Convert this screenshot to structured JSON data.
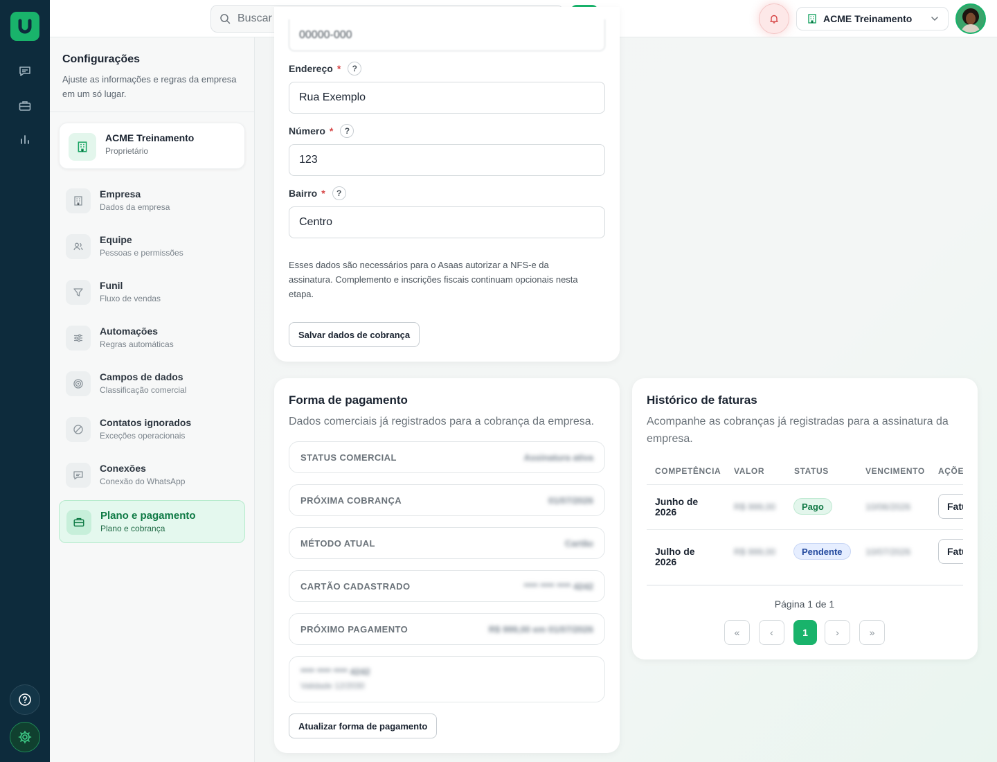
{
  "topbar": {
    "search_placeholder": "Buscar conversas, negócios e telefones",
    "company_name": "ACME Treinamento"
  },
  "settings": {
    "title": "Configurações",
    "subtitle": "Ajuste as informações e regras da empresa em um só lugar.",
    "company": {
      "name": "ACME Treinamento",
      "role": "Proprietário"
    },
    "items": [
      {
        "label": "Empresa",
        "sub": "Dados da empresa"
      },
      {
        "label": "Equipe",
        "sub": "Pessoas e permissões"
      },
      {
        "label": "Funil",
        "sub": "Fluxo de vendas"
      },
      {
        "label": "Automações",
        "sub": "Regras automáticas"
      },
      {
        "label": "Campos de dados",
        "sub": "Classificação comercial"
      },
      {
        "label": "Contatos ignorados",
        "sub": "Exceções operacionais"
      },
      {
        "label": "Conexões",
        "sub": "Conexão do WhatsApp"
      },
      {
        "label": "Plano e pagamento",
        "sub": "Plano e cobrança"
      }
    ]
  },
  "billing_form": {
    "cep_value": "00000-000",
    "endereco_label": "Endereço",
    "endereco_value": "Rua Exemplo",
    "numero_label": "Número",
    "numero_value": "123",
    "bairro_label": "Bairro",
    "bairro_value": "Centro",
    "required_mark": "*",
    "help_mark": "?",
    "note": "Esses dados são necessários para o Asaas autorizar a NFS-e da assinatura. Complemento e inscrições fiscais continuam opcionais nesta etapa.",
    "save_label": "Salvar dados de cobrança"
  },
  "payment": {
    "title": "Forma de pagamento",
    "subtitle": "Dados comerciais já registrados para a cobrança da empresa.",
    "rows": [
      {
        "key": "STATUS COMERCIAL",
        "value": "Assinatura ativa"
      },
      {
        "key": "PRÓXIMA COBRANÇA",
        "value": "01/07/2026"
      },
      {
        "key": "MÉTODO ATUAL",
        "value": "Cartão"
      },
      {
        "key": "CARTÃO CADASTRADO",
        "value": "**** **** **** 4242"
      },
      {
        "key": "PRÓXIMO PAGAMENTO",
        "value": "R$ 999,00 em 01/07/2026"
      }
    ],
    "card_number": "**** **** **** 4242",
    "card_validity": "Validade 12/2030",
    "update_label": "Atualizar forma de pagamento"
  },
  "invoices": {
    "title": "Histórico de faturas",
    "subtitle": "Acompanhe as cobranças já registradas para a assinatura da empresa.",
    "columns": [
      "COMPETÊNCIA",
      "VALOR",
      "STATUS",
      "VENCIMENTO",
      "AÇÕE"
    ],
    "rows": [
      {
        "competencia": "Junho de 2026",
        "valor": "R$ 999,00",
        "status": "Pago",
        "vencimento": "10/06/2026",
        "acao": "Fatura"
      },
      {
        "competencia": "Julho de 2026",
        "valor": "R$ 999,00",
        "status": "Pendente",
        "vencimento": "10/07/2026",
        "acao": "Fatura"
      }
    ],
    "page_info": "Página 1 de 1",
    "current_page": "1",
    "pager": {
      "first": "«",
      "prev": "‹",
      "next": "›",
      "last": "»"
    }
  },
  "colors": {
    "brand": "#19b36b",
    "rail": "#0d2b3c",
    "danger": "#d64545"
  }
}
